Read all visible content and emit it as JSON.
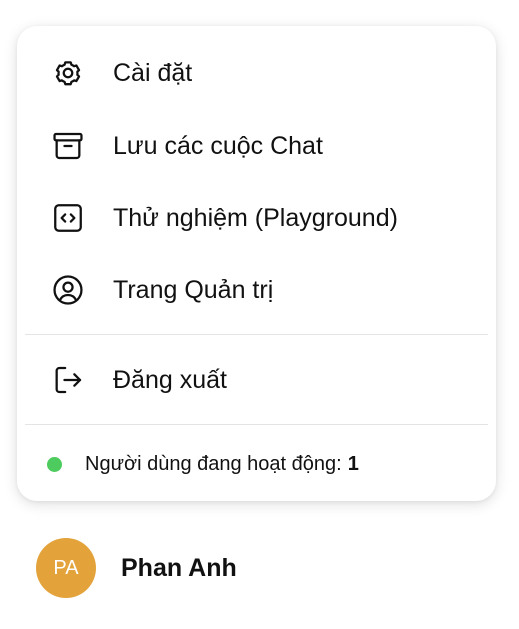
{
  "menu": {
    "items": [
      {
        "label": "Cài đặt",
        "icon": "gear-icon"
      },
      {
        "label": "Lưu các cuộc Chat",
        "icon": "archive-icon"
      },
      {
        "label": "Thử nghiệm (Playground)",
        "icon": "code-icon"
      },
      {
        "label": "Trang Quản trị",
        "icon": "user-circle-icon"
      }
    ],
    "signout": {
      "label": "Đăng xuất",
      "icon": "sign-out-icon"
    },
    "status": {
      "label": "Người dùng đang hoạt động:",
      "count": "1",
      "dot_color": "#4ecb5e"
    }
  },
  "user": {
    "initials": "PA",
    "name": "Phan Anh",
    "avatar_color": "#e3a33a"
  }
}
